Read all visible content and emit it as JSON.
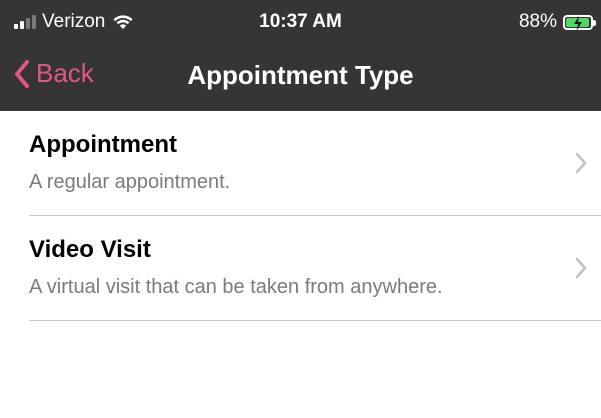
{
  "status_bar": {
    "carrier": "Verizon",
    "time": "10:37 AM",
    "battery_percent": "88%",
    "battery_level": 0.88,
    "signal_icon": "cellular-signal-icon",
    "wifi_icon": "wifi-icon",
    "battery_icon": "battery-charging-icon"
  },
  "nav": {
    "back_label": "Back",
    "title": "Appointment Type",
    "accent_color": "#e0558a",
    "bar_color": "#353535"
  },
  "list": {
    "items": [
      {
        "title": "Appointment",
        "subtitle": "A regular appointment."
      },
      {
        "title": "Video Visit",
        "subtitle": "A virtual visit that can be taken from anywhere."
      }
    ]
  }
}
